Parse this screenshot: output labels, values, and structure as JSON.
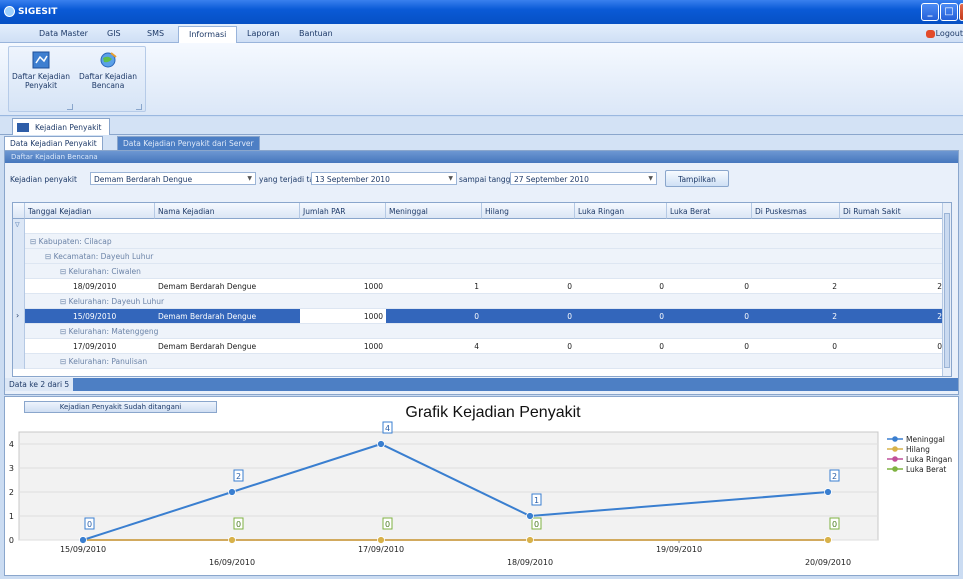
{
  "window": {
    "title": "SIGESIT"
  },
  "menu": {
    "items": [
      "Data Master",
      "GIS",
      "SMS",
      "Informasi",
      "Laporan",
      "Bantuan"
    ],
    "active": "Informasi",
    "logout": "Logout"
  },
  "ribbon": {
    "btn1": {
      "line1": "Daftar Kejadian",
      "line2": "Penyakit"
    },
    "btn2": {
      "line1": "Daftar Kejadian",
      "line2": "Bencana"
    }
  },
  "doc_tab": "Kejadian Penyakit",
  "subtabs": {
    "tab1": "Data Kejadian Penyakit",
    "tab2": "Data Kejadian Penyakit dari Server"
  },
  "panel": {
    "header": "Daftar Kejadian Bencana",
    "label_kejadian": "Kejadian penyakit",
    "combo_penyakit": "Demam Berdarah Dengue",
    "label_terjadi": "yang terjadi tanggal",
    "combo_dari": "13 September 2010",
    "label_sampai": "sampai tanggal",
    "combo_sampai": "27 September 2010",
    "button_tampilkan": "Tampilkan",
    "footer": "Data ke 2 dari 5"
  },
  "grid": {
    "columns": [
      "Tanggal Kejadian",
      "Nama Kejadian",
      "Jumlah PAR",
      "Meninggal",
      "Hilang",
      "Luka Ringan",
      "Luka Berat",
      "Di Puskesmas",
      "Di Rumah Sakit"
    ],
    "groups": {
      "kabupaten": "Kabupaten: Cilacap",
      "kecamatan": "Kecamatan: Dayeuh Luhur",
      "kel1": "Kelurahan: Ciwalen",
      "kel2": "Kelurahan: Dayeuh Luhur",
      "kel3": "Kelurahan: Matenggeng",
      "kel4": "Kelurahan: Panulisan"
    },
    "rows": [
      {
        "tanggal": "18/09/2010",
        "nama": "Demam Berdarah Dengue",
        "par": "1000",
        "meninggal": "1",
        "hilang": "0",
        "luka_ringan": "0",
        "luka_berat": "0",
        "puskesmas": "2",
        "rumah_sakit": "2"
      },
      {
        "tanggal": "15/09/2010",
        "nama": "Demam Berdarah Dengue",
        "par": "1000",
        "meninggal": "0",
        "hilang": "0",
        "luka_ringan": "0",
        "luka_berat": "0",
        "puskesmas": "2",
        "rumah_sakit": "2"
      },
      {
        "tanggal": "17/09/2010",
        "nama": "Demam Berdarah Dengue",
        "par": "1000",
        "meninggal": "4",
        "hilang": "0",
        "luka_ringan": "0",
        "luka_berat": "0",
        "puskesmas": "0",
        "rumah_sakit": "0"
      }
    ]
  },
  "chart_button": "Kejadian Penyakit Sudah ditangani",
  "chart_data": {
    "type": "line",
    "title": "Grafik Kejadian Penyakit",
    "x": [
      "15/09/2010",
      "16/09/2010",
      "17/09/2010",
      "18/09/2010",
      "19/09/2010",
      "20/09/2010"
    ],
    "ylim": [
      0,
      4.5
    ],
    "yticks": [
      "0",
      "1",
      "2",
      "3",
      "4"
    ],
    "legend_position": "right",
    "series": [
      {
        "name": "Meninggal",
        "color": "#3a7fd0",
        "points": [
          {
            "x": "15/09/2010",
            "y": 0
          },
          {
            "x": "16/09/2010",
            "y": 2
          },
          {
            "x": "17/09/2010",
            "y": 4
          },
          {
            "x": "18/09/2010",
            "y": 1
          },
          {
            "x": "20/09/2010",
            "y": 2
          }
        ]
      },
      {
        "name": "Hilang",
        "color": "#d8b24a",
        "points": [
          {
            "x": "15/09/2010",
            "y": 0
          },
          {
            "x": "16/09/2010",
            "y": 0
          },
          {
            "x": "17/09/2010",
            "y": 0
          },
          {
            "x": "18/09/2010",
            "y": 0
          },
          {
            "x": "20/09/2010",
            "y": 0
          }
        ]
      },
      {
        "name": "Luka Ringan",
        "color": "#c0509a",
        "points": [
          {
            "x": "15/09/2010",
            "y": 0
          },
          {
            "x": "16/09/2010",
            "y": 0
          },
          {
            "x": "17/09/2010",
            "y": 0
          },
          {
            "x": "18/09/2010",
            "y": 0
          },
          {
            "x": "20/09/2010",
            "y": 0
          }
        ]
      },
      {
        "name": "Luka Berat",
        "color": "#7fb241",
        "points": [
          {
            "x": "15/09/2010",
            "y": 0
          },
          {
            "x": "16/09/2010",
            "y": 0
          },
          {
            "x": "17/09/2010",
            "y": 0
          },
          {
            "x": "18/09/2010",
            "y": 0
          },
          {
            "x": "20/09/2010",
            "y": 0
          }
        ]
      }
    ]
  }
}
